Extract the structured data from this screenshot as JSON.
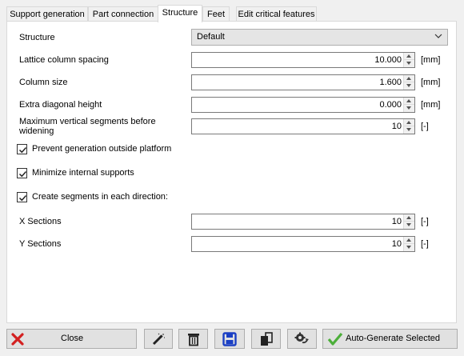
{
  "tabs": [
    {
      "label": "Support generation"
    },
    {
      "label": "Part connection"
    },
    {
      "label": "Structure"
    },
    {
      "label": "Feet"
    },
    {
      "label": "Edit critical features"
    }
  ],
  "active_tab": "Structure",
  "structure": {
    "label": "Structure",
    "selected": "Default"
  },
  "fields": {
    "lattice": {
      "label": "Lattice column spacing",
      "value": "10.000",
      "unit": "[mm]"
    },
    "column_size": {
      "label": "Column size",
      "value": "1.600",
      "unit": "[mm]"
    },
    "diagonal": {
      "label": "Extra diagonal height",
      "value": "0.000",
      "unit": "[mm]"
    },
    "max_segments": {
      "label_line1": "Maximum vertical segments before",
      "label_line2": "widening",
      "value": "10",
      "unit": "[-]"
    },
    "x_sections": {
      "label": "X Sections",
      "value": "10",
      "unit": "[-]"
    },
    "y_sections": {
      "label": "Y Sections",
      "value": "10",
      "unit": "[-]"
    }
  },
  "checkboxes": {
    "prevent": {
      "label": "Prevent generation outside platform",
      "checked": true
    },
    "minimize": {
      "label": "Minimize internal supports",
      "checked": true
    },
    "segments": {
      "label": "Create segments in each direction:",
      "checked": true
    }
  },
  "buttons": {
    "close": "Close",
    "auto_generate": "Auto-Generate Selected"
  },
  "icons": [
    "close-x-icon",
    "magic-wand-icon",
    "trash-icon",
    "save-icon",
    "copy-icon",
    "gear-refresh-icon",
    "checkmark-icon",
    "chevron-down-icon"
  ],
  "colors": {
    "close_icon": "#d32020",
    "save_icon": "#1a3fc4",
    "check_icon": "#4caf3a"
  }
}
